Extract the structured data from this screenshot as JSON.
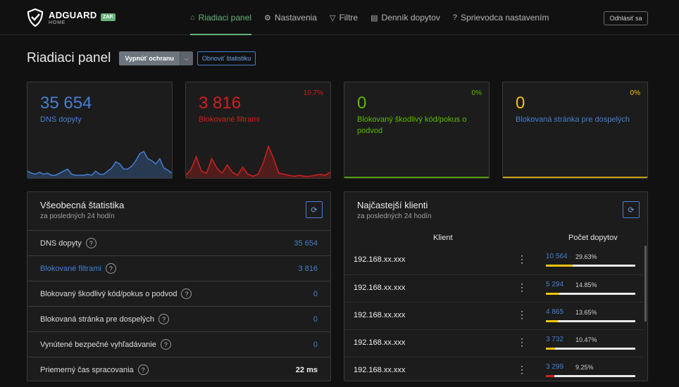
{
  "brand": {
    "name": "ADGUARD",
    "sub": "HOME",
    "status": "ZAP."
  },
  "nav": [
    {
      "label": "Riadiaci panel",
      "icon": "home-icon"
    },
    {
      "label": "Nastavenia",
      "icon": "gear-icon"
    },
    {
      "label": "Filtre",
      "icon": "filter-icon"
    },
    {
      "label": "Denník dopytov",
      "icon": "document-icon"
    },
    {
      "label": "Sprievodca nastavením",
      "icon": "help-icon"
    }
  ],
  "logout": "Odhlásiť sa",
  "page": {
    "title": "Riadiaci panel",
    "toggle_label": "Vypnúť ochranu",
    "refresh_label": "Obnoviť štatistiku"
  },
  "cards": [
    {
      "value": "35 654",
      "label": "DNS dopyty",
      "pct": "",
      "color": "#467fcf",
      "spark": [
        6,
        4,
        3,
        5,
        3,
        4,
        2,
        2,
        4,
        6,
        8,
        3,
        2,
        2,
        2,
        3,
        2,
        6,
        3,
        3,
        6,
        9,
        15,
        13,
        8,
        8,
        11,
        16,
        23,
        25,
        18,
        16,
        13,
        18,
        9,
        7,
        4
      ]
    },
    {
      "value": "3 816",
      "label": "Blokované filtrami",
      "pct": "10,7%",
      "color": "#cd201f",
      "spark": [
        2,
        8,
        20,
        6,
        4,
        18,
        9,
        4,
        12,
        5,
        2,
        10,
        3,
        1,
        3,
        14,
        30,
        18,
        4,
        3,
        2,
        1,
        2,
        1,
        1,
        2,
        3,
        2,
        5
      ]
    },
    {
      "value": "0",
      "label": "Blokovaný škodlivý kód/pokus o podvod",
      "pct": "0%",
      "color": "#5eba00",
      "spark": [
        0,
        0
      ]
    },
    {
      "value": "0",
      "label": "Blokovaná stránka pre dospelých",
      "pct": "0%",
      "color": "#f1c40f",
      "spark": [
        0,
        0
      ]
    }
  ],
  "general": {
    "title": "Všeobecná štatistika",
    "subtitle": "za posledných 24 hodín",
    "rows": [
      {
        "label": "DNS dopyty",
        "value": "35 654"
      },
      {
        "label": "Blokované filtrami",
        "value": "3 816"
      },
      {
        "label": "Blokovaný škodlivý kód/pokus o podvod",
        "value": "0"
      },
      {
        "label": "Blokovaná stránka pre dospelých",
        "value": "0"
      },
      {
        "label": "Vynútené bezpečné vyhľadávanie",
        "value": "0"
      },
      {
        "label": "Priemerný čas spracovania",
        "value": "22 ms"
      }
    ]
  },
  "clients": {
    "title": "Najčastejší klienti",
    "subtitle": "za posledných 24 hodín",
    "col_client": "Klient",
    "col_count": "Počet dopytov",
    "rows": [
      {
        "ip": "192.168.xx.xxx",
        "count": "10 564",
        "pct": "29.63%",
        "fill": 0.2963,
        "color": "#f1c40f"
      },
      {
        "ip": "192.168.xx.xxx",
        "count": "5 294",
        "pct": "14.85%",
        "fill": 0.1485,
        "color": "#f1c40f"
      },
      {
        "ip": "192.168.xx.xxx",
        "count": "4 865",
        "pct": "13.65%",
        "fill": 0.1365,
        "color": "#f1c40f"
      },
      {
        "ip": "192.168.xx.xxx",
        "count": "3 732",
        "pct": "10.47%",
        "fill": 0.1047,
        "color": "#f1c40f"
      },
      {
        "ip": "192.168.xx.xxx",
        "count": "3 299",
        "pct": "9.25%",
        "fill": 0.0925,
        "color": "#cd201f"
      }
    ]
  }
}
